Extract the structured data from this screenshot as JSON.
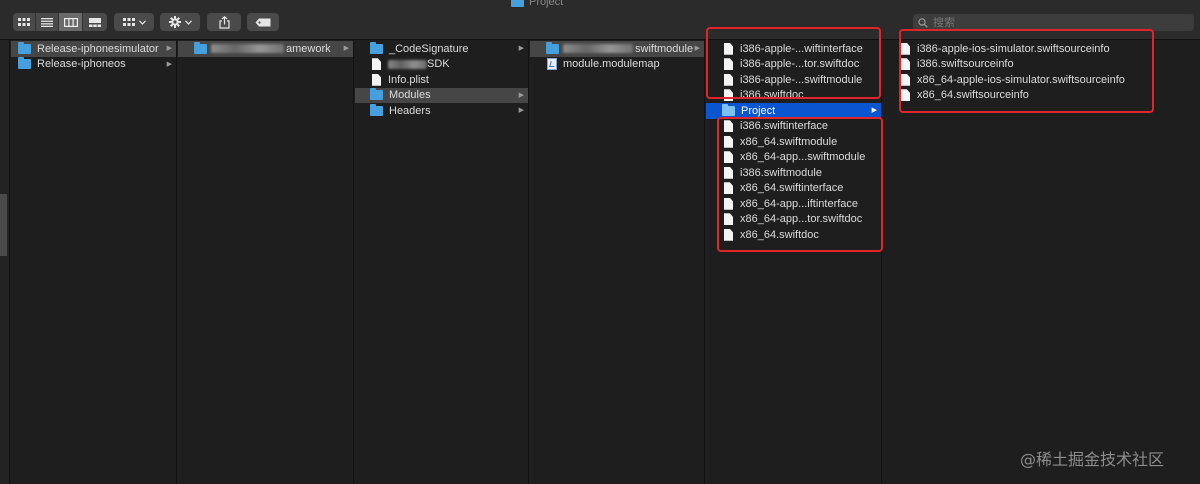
{
  "window": {
    "title": "Project"
  },
  "toolbar": {
    "view_buttons": [
      "icon-view",
      "list-view",
      "column-view",
      "gallery-view"
    ],
    "group_button_icon": "grid-icon",
    "action_button_icon": "gear-icon",
    "share_button_icon": "share-icon",
    "tag_button_icon": "tag-icon"
  },
  "search": {
    "placeholder": "搜索",
    "value": ""
  },
  "columns": [
    {
      "items": [
        {
          "label": "Release-iphonesimulator",
          "icon": "folder-icon",
          "has_children": true,
          "selected": "gray"
        },
        {
          "label": "Release-iphoneos",
          "icon": "folder-icon",
          "has_children": true
        }
      ]
    },
    {
      "items": [
        {
          "label": "amework",
          "icon": "folder-icon",
          "has_children": true,
          "selected": "gray",
          "redacted_prefix": true
        }
      ]
    },
    {
      "items": [
        {
          "label": "_CodeSignature",
          "icon": "folder-icon",
          "has_children": true
        },
        {
          "label": "SDK",
          "icon": "document-icon",
          "has_children": false,
          "redacted_prefix": true
        },
        {
          "label": "Info.plist",
          "icon": "document-icon",
          "has_children": false
        },
        {
          "label": "Modules",
          "icon": "folder-icon",
          "has_children": true,
          "selected": "gray"
        },
        {
          "label": "Headers",
          "icon": "folder-icon",
          "has_children": true
        }
      ]
    },
    {
      "items": [
        {
          "label": "swiftmodule",
          "icon": "folder-icon",
          "has_children": true,
          "selected": "gray",
          "redacted_prefix": true
        },
        {
          "label": "module.modulemap",
          "icon": "modulemap-icon",
          "has_children": false
        }
      ]
    },
    {
      "items": [
        {
          "label": "i386-apple-...wiftinterface",
          "icon": "document-icon"
        },
        {
          "label": "i386-apple-...tor.swiftdoc",
          "icon": "document-icon"
        },
        {
          "label": "i386-apple-...swiftmodule",
          "icon": "document-icon"
        },
        {
          "label": "i386.swiftdoc",
          "icon": "document-icon"
        },
        {
          "label": "Project",
          "icon": "folder-icon",
          "has_children": true,
          "selected": "blue"
        },
        {
          "label": "i386.swiftinterface",
          "icon": "document-icon"
        },
        {
          "label": "x86_64.swiftmodule",
          "icon": "document-icon"
        },
        {
          "label": "x86_64-app...swiftmodule",
          "icon": "document-icon"
        },
        {
          "label": "i386.swiftmodule",
          "icon": "document-icon"
        },
        {
          "label": "x86_64.swiftinterface",
          "icon": "document-icon"
        },
        {
          "label": "x86_64-app...iftinterface",
          "icon": "document-icon"
        },
        {
          "label": "x86_64-app...tor.swiftdoc",
          "icon": "document-icon"
        },
        {
          "label": "x86_64.swiftdoc",
          "icon": "document-icon"
        }
      ]
    },
    {
      "items": [
        {
          "label": "i386-apple-ios-simulator.swiftsourceinfo",
          "icon": "document-icon"
        },
        {
          "label": "i386.swiftsourceinfo",
          "icon": "document-icon"
        },
        {
          "label": "x86_64-apple-ios-simulator.swiftsourceinfo",
          "icon": "document-icon"
        },
        {
          "label": "x86_64.swiftsourceinfo",
          "icon": "document-icon"
        }
      ]
    }
  ],
  "colors": {
    "selection_blue": "#0a55d0",
    "selection_gray": "#464646",
    "annotation_red": "#e0262b",
    "folder_blue": "#45a0dd"
  },
  "watermark": "@稀土掘金技术社区"
}
